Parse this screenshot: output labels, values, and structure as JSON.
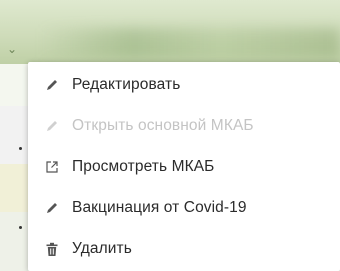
{
  "context_menu": {
    "items": [
      {
        "label": "Редактировать",
        "icon": "pencil-icon",
        "disabled": false
      },
      {
        "label": "Открыть основной МКАБ",
        "icon": "pencil-icon",
        "disabled": true
      },
      {
        "label": "Просмотреть МКАБ",
        "icon": "external-link-icon",
        "disabled": false
      },
      {
        "label": "Вакцинация от Covid-19",
        "icon": "pencil-icon",
        "disabled": false
      },
      {
        "label": "Удалить",
        "icon": "trash-icon",
        "disabled": false
      }
    ]
  },
  "colors": {
    "menu_text": "#2b2b2b",
    "menu_disabled_text": "#c4c4c4",
    "icon": "#555555",
    "icon_disabled": "#d0d0d0",
    "header_green": "#cfdcba"
  }
}
